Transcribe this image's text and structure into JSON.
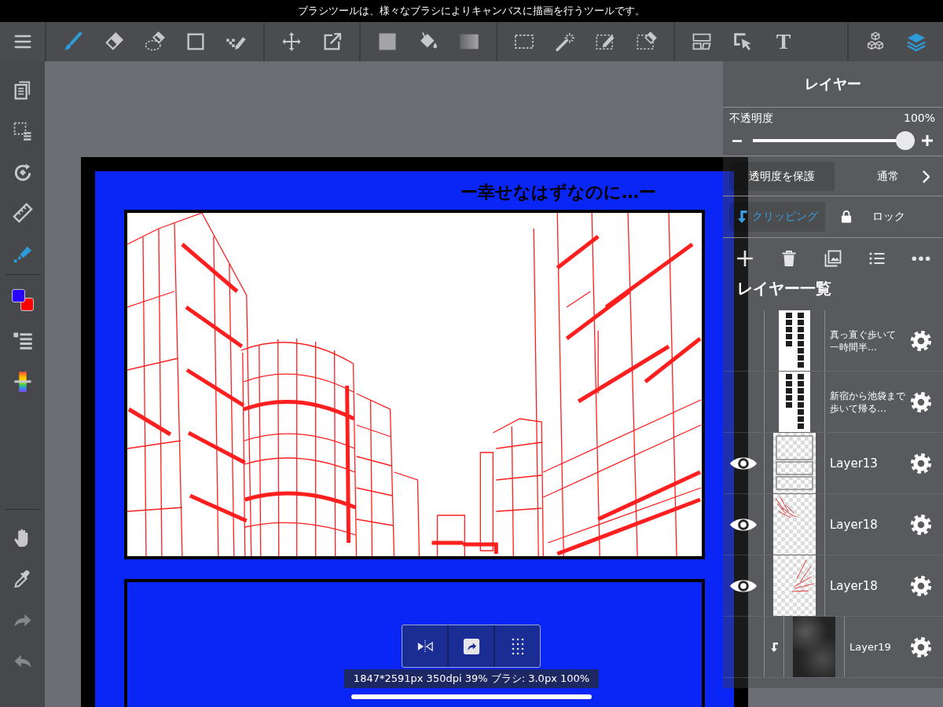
{
  "hint_bar": {
    "text": "ブラシツールは、様々なブラシによりキャンバスに描画を行うツールです。"
  },
  "toolbar": {
    "groups": [
      [
        {
          "kind": "menu",
          "selected": false
        }
      ],
      [
        {
          "kind": "brush",
          "selected": true
        },
        {
          "kind": "eraser",
          "selected": false
        },
        {
          "kind": "lasso-eraser",
          "selected": false
        },
        {
          "kind": "shape",
          "selected": false
        },
        {
          "kind": "dot-pen",
          "selected": false
        }
      ],
      [
        {
          "kind": "move",
          "selected": false
        },
        {
          "kind": "transform",
          "selected": false
        }
      ],
      [
        {
          "kind": "fill",
          "selected": false
        },
        {
          "kind": "bucket",
          "selected": false
        },
        {
          "kind": "gradient",
          "selected": false
        }
      ],
      [
        {
          "kind": "select-rect",
          "selected": false
        },
        {
          "kind": "magic-wand",
          "selected": false
        },
        {
          "kind": "select-pen",
          "selected": false
        },
        {
          "kind": "select-eraser",
          "selected": false
        }
      ],
      [
        {
          "kind": "frame-divide",
          "selected": false
        },
        {
          "kind": "object-select",
          "selected": false
        },
        {
          "kind": "text",
          "label": "T",
          "selected": false
        }
      ],
      [
        {
          "kind": "cubes",
          "selected": false
        },
        {
          "kind": "layers",
          "selected": true
        }
      ]
    ]
  },
  "sidebar": {
    "groups": [
      [
        {
          "kind": "pages",
          "on": false,
          "disabled": false
        },
        {
          "kind": "select-layer",
          "on": false,
          "disabled": false
        },
        {
          "kind": "rotate",
          "on": false,
          "disabled": false
        },
        {
          "kind": "ruler",
          "on": false,
          "disabled": false
        },
        {
          "kind": "pen",
          "on": true,
          "disabled": false
        }
      ],
      [
        {
          "kind": "colors",
          "on": false,
          "disabled": false,
          "swatches": [
            {
              "color": "#2a00ff"
            },
            {
              "color": "#ff0000"
            }
          ]
        },
        {
          "kind": "layer-settings",
          "on": false,
          "disabled": false
        },
        {
          "kind": "hue-slider",
          "on": false,
          "disabled": false
        }
      ],
      [
        {
          "kind": "hand",
          "on": false,
          "disabled": false
        },
        {
          "kind": "eyedropper",
          "on": false,
          "disabled": false
        },
        {
          "kind": "redo",
          "on": false,
          "disabled": true
        },
        {
          "kind": "undo",
          "on": false,
          "disabled": true
        }
      ]
    ]
  },
  "canvas": {
    "heading": "ー幸せなはずなのに…ー",
    "floating_tools": [
      {
        "kind": "symmetry"
      },
      {
        "kind": "snap"
      },
      {
        "kind": "grid"
      }
    ],
    "status": "1847*2591px 350dpi 39% ブラシ: 3.0px 100%"
  },
  "layer_panel": {
    "title": "レイヤー",
    "opacity": {
      "label": "不透明度",
      "reading": "100%",
      "level": 1
    },
    "protect_alpha": {
      "label": "透明度を保護",
      "on": false
    },
    "blend_mode": {
      "value": "通常"
    },
    "clipping": {
      "label": "クリッピング",
      "on": true
    },
    "lock": {
      "label": "ロック",
      "on": false
    },
    "actions": [
      {
        "kind": "add"
      },
      {
        "kind": "delete"
      },
      {
        "kind": "image"
      },
      {
        "kind": "list"
      },
      {
        "kind": "more"
      }
    ],
    "list_title": "レイヤー一覧",
    "layers": [
      {
        "name_lines": [
          "真っ直ぐ歩いて",
          "一時間半…"
        ],
        "kind": "text",
        "visible": false,
        "clipped": false
      },
      {
        "name_lines": [
          "新宿から池袋まで",
          "歩いて帰る…"
        ],
        "kind": "text",
        "visible": false,
        "clipped": false
      },
      {
        "name": "Layer13",
        "kind": "frames",
        "visible": true,
        "clipped": false
      },
      {
        "name": "Layer18",
        "kind": "sketch",
        "visible": true,
        "clipped": false
      },
      {
        "name": "Layer18",
        "kind": "strokes",
        "visible": true,
        "clipped": false
      },
      {
        "name": "Layer19",
        "kind": "texture",
        "visible": false,
        "clipped": true
      }
    ]
  }
}
